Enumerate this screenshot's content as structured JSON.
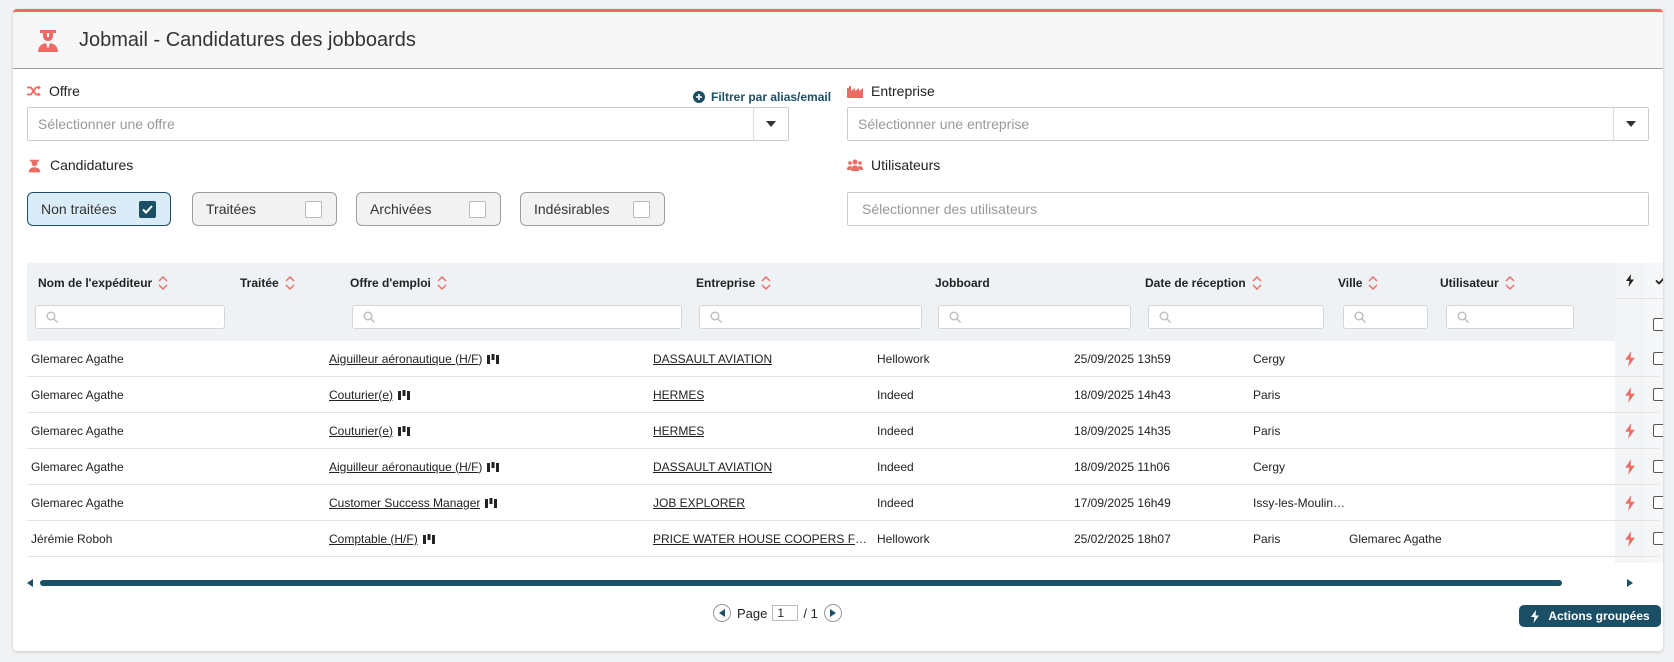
{
  "header": {
    "title": "Jobmail - Candidatures des jobboards"
  },
  "filters": {
    "offre_label": "Offre",
    "offre_placeholder": "Sélectionner une offre",
    "filter_alias_link": "Filtrer par alias/email",
    "entreprise_label": "Entreprise",
    "entreprise_placeholder": "Sélectionner une entreprise",
    "candidatures_label": "Candidatures",
    "utilisateurs_label": "Utilisateurs",
    "utilisateurs_placeholder": "Sélectionner des utilisateurs",
    "status_chips": [
      {
        "label": "Non traitées",
        "checked": true
      },
      {
        "label": "Traitées",
        "checked": false
      },
      {
        "label": "Archivées",
        "checked": false
      },
      {
        "label": "Indésirables",
        "checked": false
      }
    ]
  },
  "table": {
    "columns": {
      "sender": "Nom de l'expéditeur",
      "processed": "Traitée",
      "offer": "Offre d'emploi",
      "company": "Entreprise",
      "jobboard": "Jobboard",
      "date": "Date de réception",
      "city": "Ville",
      "user": "Utilisateur"
    },
    "rows": [
      {
        "sender": "Glemarec Agathe",
        "offer": "Aiguilleur aéronautique (H/F)",
        "company": "DASSAULT AVIATION",
        "jobboard": "Hellowork",
        "date": "25/09/2025 13h59",
        "city": "Cergy",
        "user": ""
      },
      {
        "sender": "Glemarec Agathe",
        "offer": "Couturier(e)",
        "company": "HERMES",
        "jobboard": "Indeed",
        "date": "18/09/2025 14h43",
        "city": "Paris",
        "user": ""
      },
      {
        "sender": "Glemarec Agathe",
        "offer": "Couturier(e)",
        "company": "HERMES",
        "jobboard": "Indeed",
        "date": "18/09/2025 14h35",
        "city": "Paris",
        "user": ""
      },
      {
        "sender": "Glemarec Agathe",
        "offer": "Aiguilleur aéronautique (H/F)",
        "company": "DASSAULT AVIATION",
        "jobboard": "Indeed",
        "date": "18/09/2025 11h06",
        "city": "Cergy",
        "user": ""
      },
      {
        "sender": "Glemarec Agathe",
        "offer": "Customer Success Manager",
        "company": "JOB EXPLORER",
        "jobboard": "Indeed",
        "date": "17/09/2025 16h49",
        "city": "Issy-les-Moulin…",
        "user": ""
      },
      {
        "sender": "Jérémie Roboh",
        "offer": "Comptable (H/F)",
        "company": "PRICE WATER HOUSE COOPERS FORMA …",
        "jobboard": "Hellowork",
        "date": "25/02/2025 18h07",
        "city": "Paris",
        "user": "Glemarec Agathe"
      }
    ]
  },
  "pagination": {
    "page_label": "Page",
    "current": "1",
    "total": "/ 1"
  },
  "actions": {
    "bulk_label": "Actions groupées"
  },
  "colors": {
    "accent": "#ec6b63",
    "primary": "#1b4f66",
    "chip_active_bg": "#d9ecf8"
  }
}
